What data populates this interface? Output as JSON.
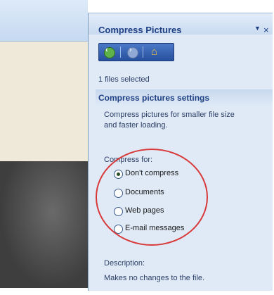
{
  "pane": {
    "title": "Compress Pictures",
    "dropdown_glyph": "▼",
    "close_glyph": "×",
    "files_selected": "1 files selected",
    "settings_title": "Compress pictures settings",
    "settings_description_line1": "Compress pictures for smaller file size",
    "settings_description_line2": "and faster loading.",
    "compress_for_label": "Compress for:",
    "options": [
      {
        "label": "Don't compress",
        "selected": true
      },
      {
        "label": "Documents",
        "selected": false
      },
      {
        "label": "Web pages",
        "selected": false
      },
      {
        "label": "E-mail messages",
        "selected": false
      }
    ],
    "description_label": "Description:",
    "description_text": "Makes no changes to the file."
  },
  "nav": {
    "back_icon": "back-arrow-icon",
    "forward_icon": "forward-arrow-icon",
    "home_icon": "home-icon"
  },
  "colors": {
    "pane_background": "#dfeaf6",
    "title_text": "#1e3f82",
    "nav_bar": "#274f9d",
    "annotation_ellipse": "#d83a3a"
  }
}
